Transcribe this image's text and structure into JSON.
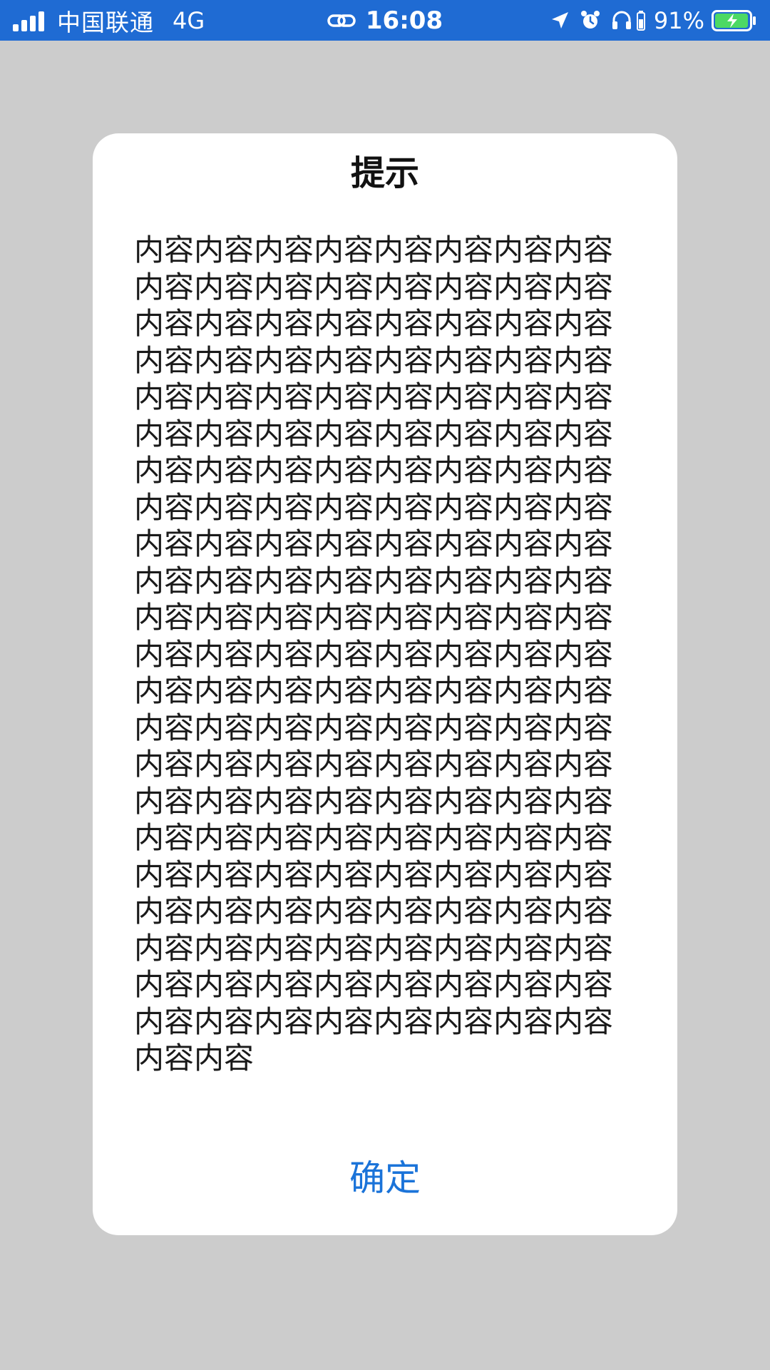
{
  "status_bar": {
    "carrier": "中国联通",
    "network": "4G",
    "time": "16:08",
    "battery_percent": "91%",
    "icons": [
      "signal-icon",
      "link-icon",
      "location-arrow-icon",
      "alarm-clock-icon",
      "headphones-icon",
      "battery-charging-icon"
    ],
    "bar_color": "#1f6bd3"
  },
  "dialog": {
    "title": "提示",
    "content": "内容内容内容内容内容内容内容内容内容内容内容内容内容内容内容内容内容内容内容内容内容内容内容内容内容内容内容内容内容内容内容内容内容内容内容内容内容内容内容内容内容内容内容内容内容内容内容内容内容内容内容内容内容内容内容内容内容内容内容内容内容内容内容内容内容内容内容内容内容内容内容内容内容内容内容内容内容内容内容内容内容内容内容内容内容内容内容内容内容内容内容内容内容内容内容内容内容内容内容内容内容内容内容内容内容内容内容内容内容内容内容内容内容内容内容内容内容内容内容内容内容内容内容内容内容内容内容内容内容内容内容内容内容内容内容内容内容内容内容内容内容内容内容内容内容内容内容内容内容内容内容内容内容内容内容内容内容内容内容内容内容内容内容内容内容内容内容内容内容内容内容内容内容内容内容内容内容内容",
    "confirm_label": "确定",
    "confirm_color": "#1a73d9"
  },
  "background_color": "#cccccc"
}
